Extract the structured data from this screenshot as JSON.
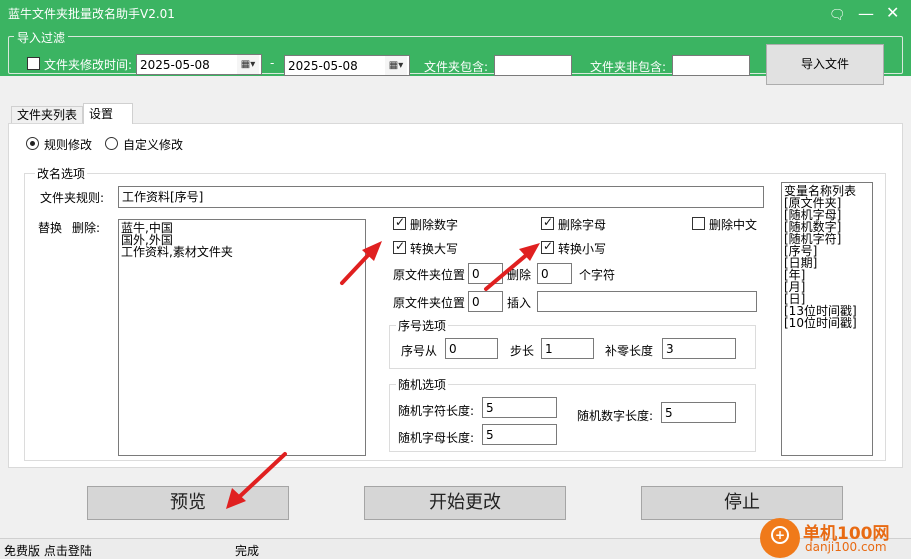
{
  "app": {
    "title": "蓝牛文件夹批量改名助手V2.01"
  },
  "window": {
    "feedback_icon": "comment-icon",
    "min_icon": "minimize-icon",
    "close_icon": "close-icon"
  },
  "import_filter": {
    "group_title": "导入过滤",
    "modified_time_label": "文件夹修改时间:",
    "modified_time_checked": false,
    "date_from": "2025-05-08",
    "date_to": "2025-05-08",
    "dash": "-",
    "contains_label": "文件夹包含:",
    "contains_value": "",
    "not_contains_label": "文件夹非包含:",
    "not_contains_value": "",
    "import_button": "导入文件"
  },
  "tabs": [
    {
      "label": "文件夹列表",
      "active": false
    },
    {
      "label": "设置",
      "active": true
    }
  ],
  "mode": {
    "rule_label": "规则修改",
    "custom_label": "自定义修改",
    "selected": "rule"
  },
  "rename": {
    "group_title": "改名选项",
    "rule_label": "文件夹规则:",
    "rule_value": "工作资料[序号]",
    "replace_label": "替换",
    "delete_label": "删除:",
    "replace_lines": [
      "蓝牛,中国",
      "国外,外国",
      "工作资料,素材文件夹"
    ],
    "options": {
      "delete_digits": {
        "label": "删除数字",
        "checked": true
      },
      "delete_letters": {
        "label": "删除字母",
        "checked": true
      },
      "delete_chinese": {
        "label": "删除中文",
        "checked": false
      },
      "to_upper": {
        "label": "转换大写",
        "checked": true
      },
      "to_lower": {
        "label": "转换小写",
        "checked": true
      }
    },
    "pos_label1": "原文件夹位置",
    "pos_value1": "0",
    "delete_word": "删除",
    "delete_count": "0",
    "chars_label": "个字符",
    "pos_label2": "原文件夹位置",
    "pos_value2": "0",
    "insert_label": "插入",
    "insert_value": ""
  },
  "sequence": {
    "group_title": "序号选项",
    "from_label": "序号从",
    "from_value": "0",
    "step_label": "步长",
    "step_value": "1",
    "pad_label": "补零长度",
    "pad_value": "3"
  },
  "random": {
    "group_title": "随机选项",
    "char_len_label": "随机字符长度:",
    "char_len_value": "5",
    "letter_len_label": "随机字母长度:",
    "letter_len_value": "5",
    "digit_len_label": "随机数字长度:",
    "digit_len_value": "5"
  },
  "variables": {
    "title": "变量名称列表",
    "items": [
      "[原文件夹]",
      "[随机字母]",
      "[随机数字]",
      "[随机字符]",
      "[序号]",
      "[日期]",
      "[年]",
      "[月]",
      "[日]",
      "[13位时间戳]",
      "[10位时间戳]"
    ]
  },
  "actions": {
    "preview": "预览",
    "start": "开始更改",
    "stop": "停止"
  },
  "status": {
    "left": "免费版 点击登陆",
    "middle": "完成"
  },
  "watermark": {
    "text": "单机100网",
    "url": "danji100.com"
  },
  "colors": {
    "title_bar": "#3bb462",
    "arrow": "#e02020"
  }
}
